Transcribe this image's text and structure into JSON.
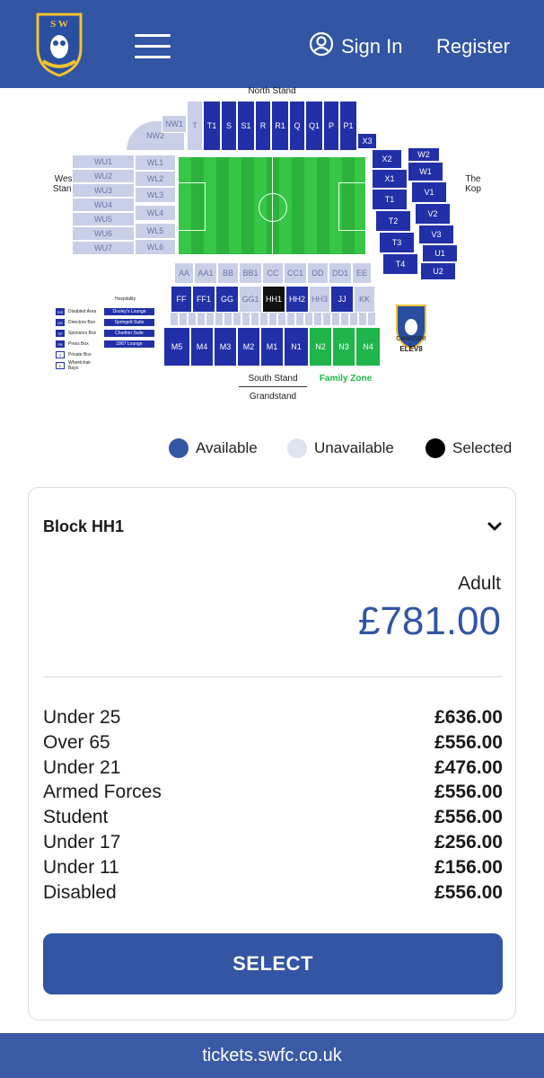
{
  "header": {
    "signin_label": "Sign In",
    "register_label": "Register"
  },
  "map": {
    "stands": {
      "north": "North Stand",
      "west": "West Stand",
      "kop": "The Kop",
      "south": "South Stand",
      "grandstand": "Grandstand",
      "family_zone": "Family Zone"
    },
    "hospitality_title": "Hospitality",
    "key": [
      {
        "code": "DIS",
        "label": "Disabled Area"
      },
      {
        "code": "DR",
        "label": "Directors Box"
      },
      {
        "code": "SP",
        "label": "Sponsors Box"
      },
      {
        "code": "PB",
        "label": "Press Box"
      },
      {
        "code": "3",
        "label": "Private Box"
      },
      {
        "code": "♿",
        "label": "Wheelchair Bays"
      }
    ],
    "lounges": [
      "Dooley's Lounge",
      "Springett Suite",
      "Charlton Suite",
      "1867 Lounge"
    ],
    "sponsor": "CHANSIRI",
    "sponsor_sub": "ELEV8"
  },
  "legend": {
    "available": "Available",
    "unavailable": "Unavailable",
    "selected": "Selected",
    "colors": {
      "available": "#3255a4",
      "unavailable": "#dfe5ef",
      "selected": "#000000"
    }
  },
  "card": {
    "block_title": "Block HH1",
    "adult_label": "Adult",
    "adult_price": "£781.00",
    "prices": [
      {
        "label": "Under 25",
        "price": "£636.00"
      },
      {
        "label": "Over 65",
        "price": "£556.00"
      },
      {
        "label": "Under 21",
        "price": "£476.00"
      },
      {
        "label": "Armed Forces",
        "price": "£556.00"
      },
      {
        "label": "Student",
        "price": "£556.00"
      },
      {
        "label": "Under 17",
        "price": "£256.00"
      },
      {
        "label": "Under 11",
        "price": "£156.00"
      },
      {
        "label": "Disabled",
        "price": "£556.00"
      }
    ],
    "select_label": "SELECT"
  },
  "footer": {
    "url": "tickets.swfc.co.uk"
  }
}
